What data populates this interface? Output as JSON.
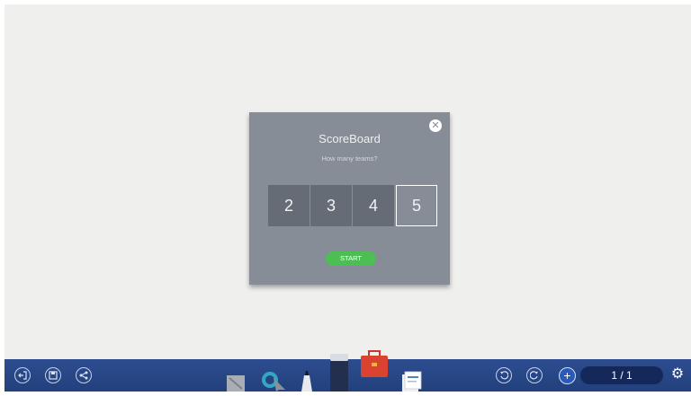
{
  "dialog": {
    "title": "ScoreBoard",
    "subtitle": "How many teams?",
    "team_options": [
      "2",
      "3",
      "4",
      "5"
    ],
    "selected": "5",
    "start_label": "START",
    "close_icon": "close-icon"
  },
  "taskbar": {
    "left_icons": [
      "exit-icon",
      "save-icon",
      "share-icon"
    ],
    "tools": [
      "eraser-icon",
      "selector-icon",
      "pen-icon",
      "marker-icon",
      "toolbox-icon",
      "file-icon"
    ],
    "undo_icon": "undo-icon",
    "redo_icon": "redo-icon",
    "add_page_icon": "plus-icon",
    "page_indicator": "1 / 1",
    "settings_icon": "gear-icon"
  },
  "colors": {
    "dialog_bg": "#878d96",
    "option_bg": "#666c75",
    "start_green": "#4cbe54",
    "taskbar_blue": "#2d4d90"
  }
}
